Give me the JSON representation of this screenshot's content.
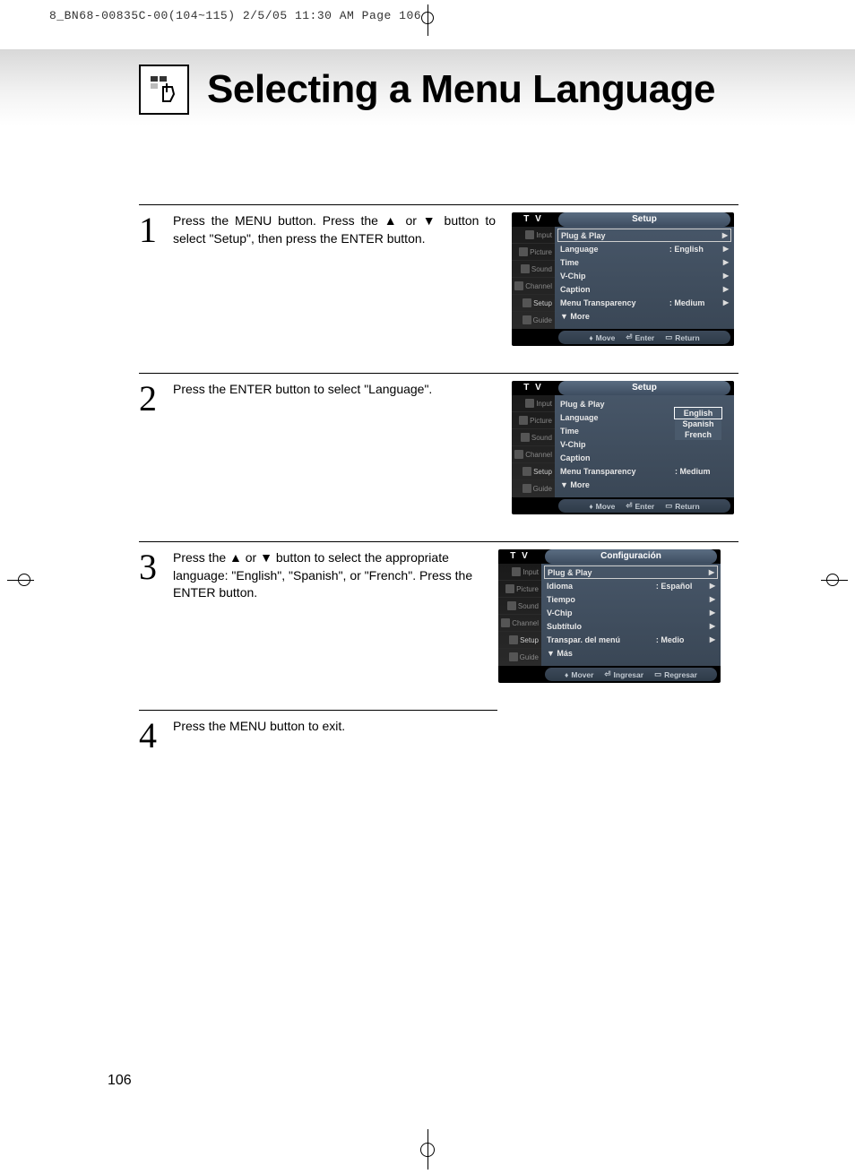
{
  "print_header": "8_BN68-00835C-00(104~115)  2/5/05  11:30 AM  Page 106",
  "page_number": "106",
  "title": "Selecting a Menu Language",
  "steps": [
    {
      "num": "1",
      "text": "Press the MENU button. Press the ▲ or ▼ button to select \"Setup\", then press the ENTER button."
    },
    {
      "num": "2",
      "text": "Press the ENTER button to select \"Language\"."
    },
    {
      "num": "3",
      "text": "Press the ▲ or ▼ button to select the appropriate language: \"English\", \"Spanish\", or \"French\". Press the ENTER button."
    },
    {
      "num": "4",
      "text": "Press the MENU button to exit."
    }
  ],
  "osd": {
    "tv_label": "T V",
    "sidebar": [
      "Input",
      "Picture",
      "Sound",
      "Channel",
      "Setup",
      "Guide"
    ],
    "screen1": {
      "title": "Setup",
      "rows": [
        {
          "label": "Plug & Play",
          "val": "",
          "boxed": true
        },
        {
          "label": "Language",
          "val": ": English"
        },
        {
          "label": "Time",
          "val": ""
        },
        {
          "label": "V-Chip",
          "val": ""
        },
        {
          "label": "Caption",
          "val": ""
        },
        {
          "label": "Menu Transparency",
          "val": ": Medium"
        },
        {
          "label": "▼ More",
          "val": "",
          "noarr": true
        }
      ],
      "footer": {
        "move": "Move",
        "enter": "Enter",
        "return": "Return"
      }
    },
    "screen2": {
      "title": "Setup",
      "rows": [
        {
          "label": "Plug & Play",
          "val": ""
        },
        {
          "label": "Language",
          "val": ":"
        },
        {
          "label": "Time",
          "val": ""
        },
        {
          "label": "V-Chip",
          "val": ""
        },
        {
          "label": "Caption",
          "val": ""
        },
        {
          "label": "Menu Transparency",
          "val": ": Medium"
        },
        {
          "label": "▼ More",
          "val": "",
          "noarr": true
        }
      ],
      "popup": [
        "English",
        "Spanish",
        "French"
      ],
      "footer": {
        "move": "Move",
        "enter": "Enter",
        "return": "Return"
      }
    },
    "screen3": {
      "title": "Configuración",
      "rows": [
        {
          "label": "Plug & Play",
          "val": "",
          "boxed": true
        },
        {
          "label": "Idioma",
          "val": ": Español"
        },
        {
          "label": "Tiempo",
          "val": ""
        },
        {
          "label": "V-Chip",
          "val": ""
        },
        {
          "label": "Subtítulo",
          "val": ""
        },
        {
          "label": "Transpar. del menú",
          "val": ": Medio"
        },
        {
          "label": "▼ Más",
          "val": "",
          "noarr": true
        }
      ],
      "footer": {
        "move": "Mover",
        "enter": "Ingresar",
        "return": "Regresar"
      }
    }
  }
}
